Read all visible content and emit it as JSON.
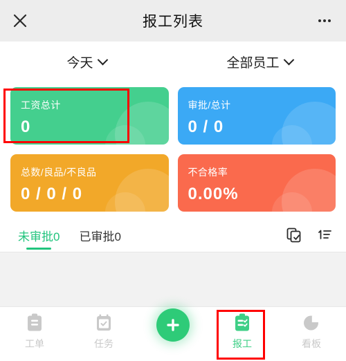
{
  "header": {
    "title": "报工列表",
    "close_icon": "close-icon",
    "more_icon": "more-options-icon"
  },
  "filters": [
    {
      "label": "今天",
      "icon": "chevron-down-icon"
    },
    {
      "label": "全部员工",
      "icon": "chevron-down-icon"
    }
  ],
  "cards": [
    {
      "label": "工资总计",
      "value": "0",
      "color": "#44cf8e"
    },
    {
      "label": "审批/总计",
      "value": "0 / 0",
      "color": "#3ba9f5"
    },
    {
      "label": "总数/良品/不良品",
      "value": "0 / 0 / 0",
      "color": "#f2a829"
    },
    {
      "label": "不合格率",
      "value": "0.00%",
      "color": "#fa6a4d"
    }
  ],
  "tabs": [
    {
      "label": "未审批0",
      "active": true
    },
    {
      "label": "已审批0",
      "active": false
    }
  ],
  "tab_actions": [
    {
      "icon": "batch-approve-icon"
    },
    {
      "icon": "sort-list-icon"
    }
  ],
  "bottom_nav": [
    {
      "label": "工单",
      "icon": "clipboard-icon",
      "active": false
    },
    {
      "label": "任务",
      "icon": "calendar-check-icon",
      "active": false
    },
    {
      "label": "报工",
      "icon": "clipboard-check-icon",
      "active": true
    },
    {
      "label": "看板",
      "icon": "pie-chart-icon",
      "active": false
    }
  ],
  "fab": {
    "icon": "plus-icon",
    "color": "#2ecb78"
  },
  "annotations": [
    {
      "name": "highlight-total-wages-card",
      "color": "#ff0000"
    },
    {
      "name": "highlight-work-report-nav",
      "color": "#ff0000"
    }
  ],
  "theme": {
    "accent": "#21c47d",
    "header_bg": "#ededed",
    "page_bg": "#f2f2f2",
    "inactive_nav": "#c9c9c9"
  }
}
